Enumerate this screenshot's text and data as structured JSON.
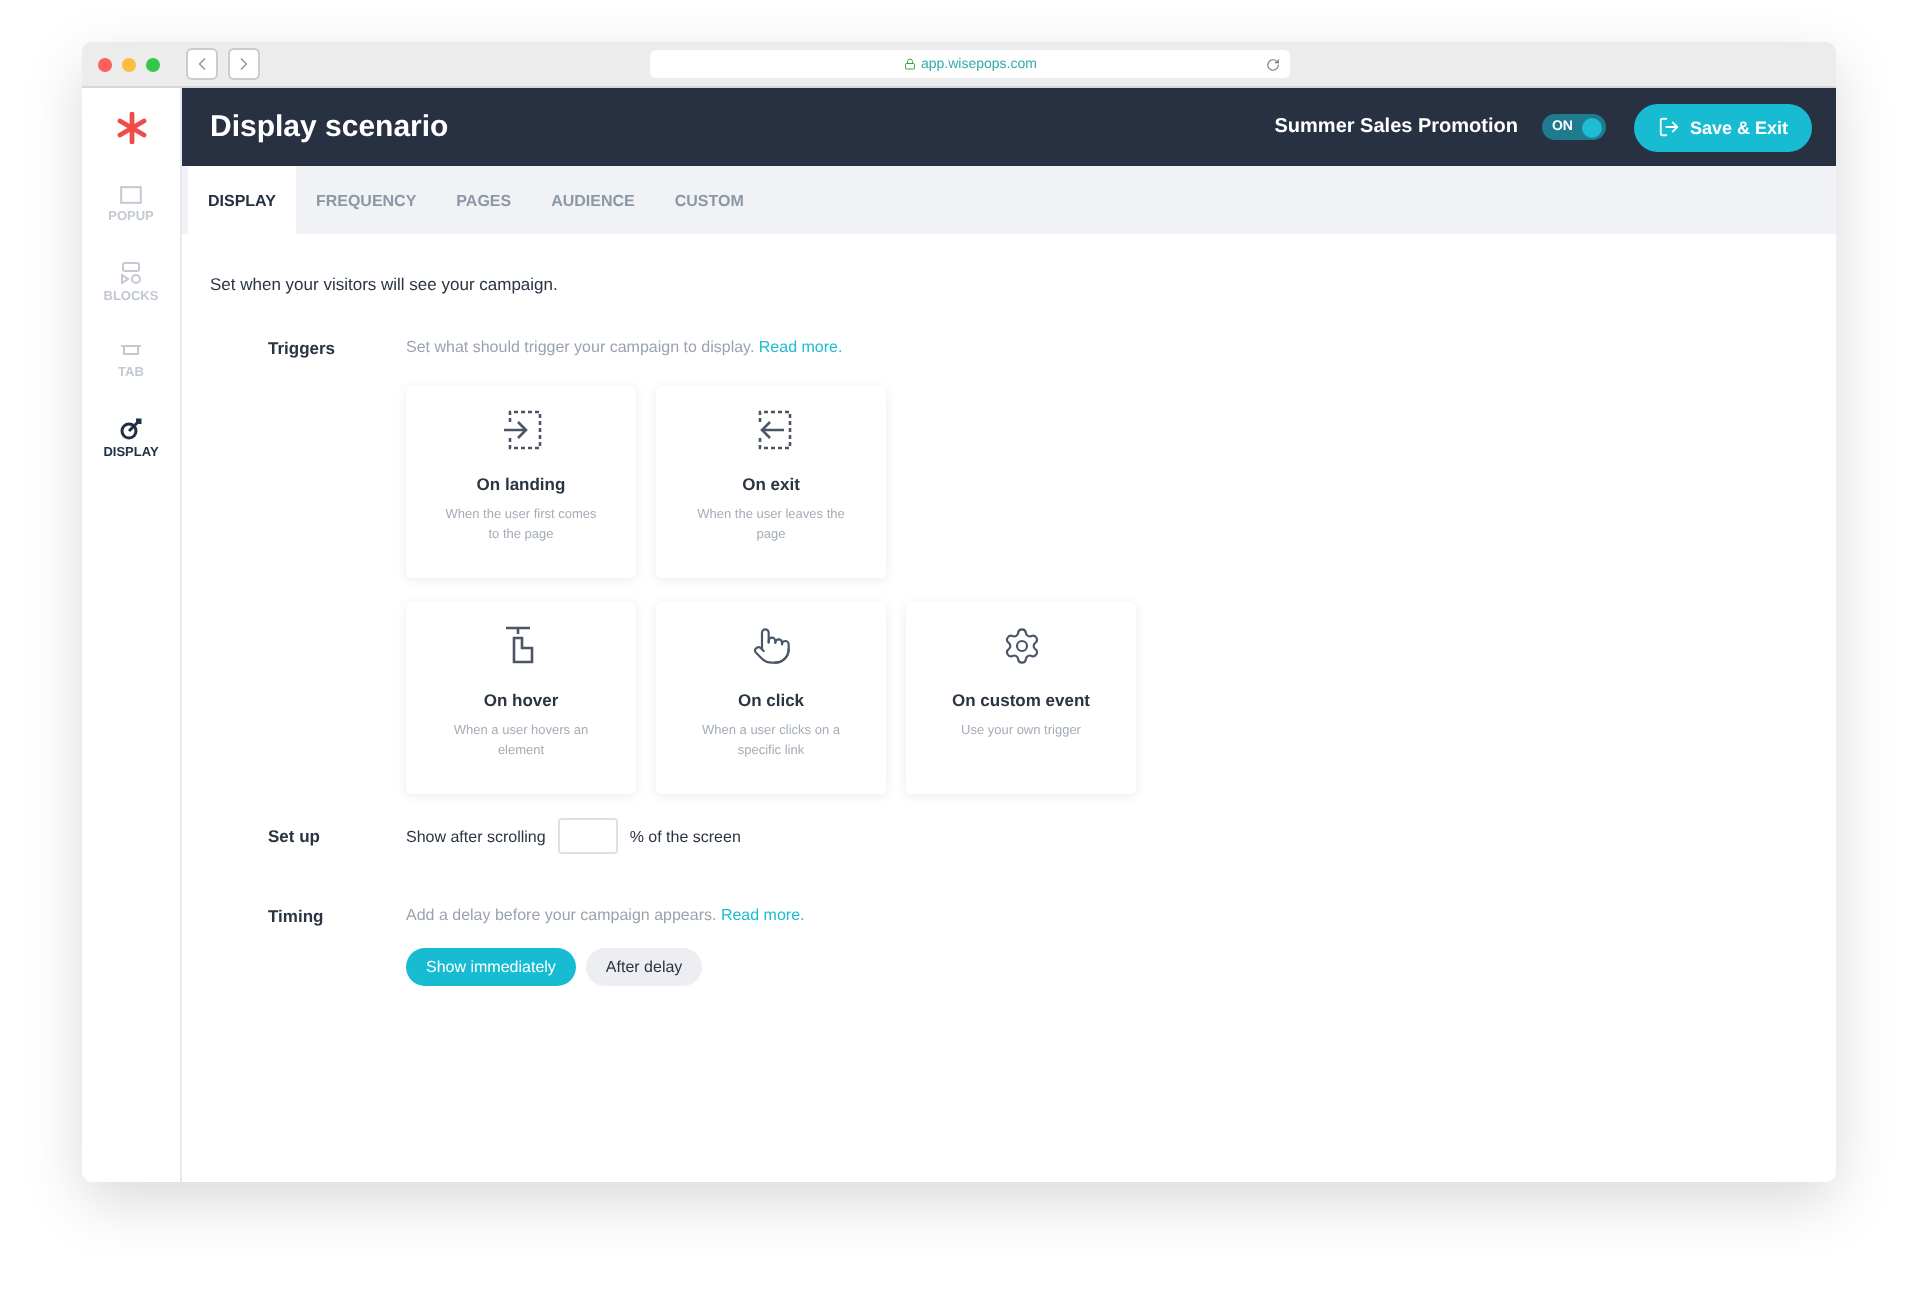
{
  "browser": {
    "url": "app.wisepops.com"
  },
  "sidebar": {
    "items": [
      {
        "label": "POPUP",
        "selected": false
      },
      {
        "label": "BLOCKS",
        "selected": false
      },
      {
        "label": "TAB",
        "selected": false
      },
      {
        "label": "DISPLAY",
        "selected": true
      }
    ]
  },
  "header": {
    "title": "Display scenario",
    "campaign": "Summer Sales Promotion",
    "toggle": {
      "label": "ON",
      "on": true
    },
    "save_button": "Save & Exit"
  },
  "tabs": [
    {
      "label": "DISPLAY",
      "selected": true
    },
    {
      "label": "FREQUENCY",
      "selected": false
    },
    {
      "label": "PAGES",
      "selected": false
    },
    {
      "label": "AUDIENCE",
      "selected": false
    },
    {
      "label": "CUSTOM",
      "selected": false
    }
  ],
  "intro": "Set when your visitors will see your campaign.",
  "triggers": {
    "label": "Triggers",
    "description": "Set what should trigger your campaign to display.",
    "link": "Read more.",
    "cards": [
      {
        "kind": "landing",
        "title": "On landing",
        "subtitle": "When the user first comes to the page"
      },
      {
        "kind": "exit",
        "title": "On exit",
        "subtitle": "When the user leaves the page"
      },
      {
        "kind": "hover",
        "title": "On hover",
        "subtitle": "When a user hovers an element"
      },
      {
        "kind": "click",
        "title": "On click",
        "subtitle": "When a user clicks on a specific link"
      },
      {
        "kind": "custom",
        "title": "On custom event",
        "subtitle": "Use your own trigger"
      }
    ]
  },
  "setup": {
    "label": "Set up",
    "before": "Show after scrolling",
    "after": "% of the screen"
  },
  "timing": {
    "label": "Timing",
    "description": "Add a delay before your campaign appears.",
    "link": "Read more.",
    "options": [
      {
        "label": "Show immediately",
        "selected": true
      },
      {
        "label": "After delay",
        "selected": false
      }
    ]
  }
}
